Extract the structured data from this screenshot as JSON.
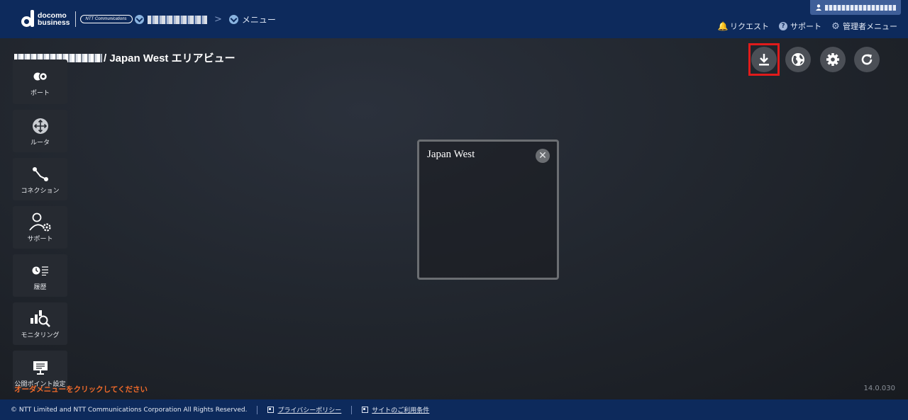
{
  "header": {
    "brand_line1": "docomo",
    "brand_line2": "business",
    "ntt_badge": "NTT Communications",
    "breadcrumb_menu_label": "メニュー",
    "links": [
      {
        "label": "リクエスト",
        "icon": "bell-icon"
      },
      {
        "label": "サポート",
        "icon": "help-icon"
      },
      {
        "label": "管理者メニュー",
        "icon": "gear-icon"
      }
    ]
  },
  "page": {
    "title_suffix": "/ Japan West エリアビュー"
  },
  "sidebar": {
    "items": [
      {
        "label": "ポート",
        "icon": "port-icon"
      },
      {
        "label": "ルータ",
        "icon": "router-icon"
      },
      {
        "label": "コネクション",
        "icon": "connection-icon"
      },
      {
        "label": "サポート",
        "icon": "support-icon"
      },
      {
        "label": "履歴",
        "icon": "history-icon"
      },
      {
        "label": "モニタリング",
        "icon": "monitoring-icon"
      },
      {
        "label": "公開ポイント設定",
        "icon": "public-point-icon"
      }
    ]
  },
  "toolbar": {
    "buttons": [
      {
        "icon": "download-icon",
        "highlighted": true
      },
      {
        "icon": "globe-icon"
      },
      {
        "icon": "settings-icon"
      },
      {
        "icon": "refresh-icon"
      }
    ],
    "highlight_color": "#e01b1b"
  },
  "region_panel": {
    "title": "Japan West",
    "close_symbol": "✕"
  },
  "hint_text": "オーダメニューをクリックしてください",
  "version": "14.0.030",
  "footer": {
    "copyright": "© NTT Limited and NTT Communications Corporation All Rights Reserved.",
    "privacy_link": "プライバシーポリシー",
    "terms_link": "サイトのご利用条件"
  },
  "colors": {
    "header_bg": "#0d2a5c",
    "hint": "#f06a2a",
    "button_bg": "#4b4f56"
  }
}
